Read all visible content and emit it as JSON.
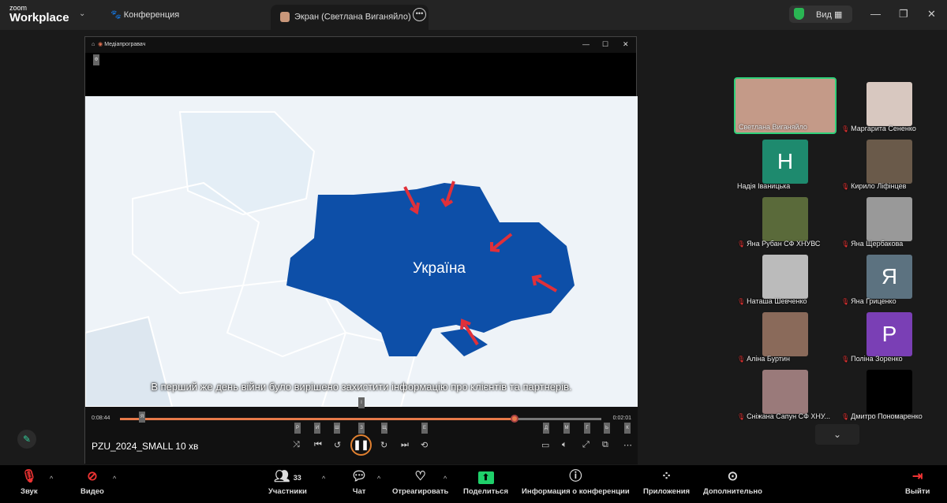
{
  "app": {
    "logo_small": "zoom",
    "logo_big": "Workplace",
    "tab_conference": "Конференция",
    "tab_screen": "Экран (Светлана Виганяйло)",
    "view_label": "Вид"
  },
  "player": {
    "title": "Медіапрогравач",
    "subtitle": "В перший же день війни було вирішено захистити інформацію про клієнтів та партнерів.",
    "map_label": "Україна",
    "time_elapsed": "0:08:44",
    "time_remaining": "0:02:01",
    "progress": 0.82,
    "file_name": "PZU_2024_SMALL 10 хв",
    "keys": [
      "Ф",
      "Я",
      "І",
      "Р",
      "И",
      "Ш",
      "З",
      "Щ",
      "Е",
      "Д",
      "М",
      "Г",
      "Ь",
      "К"
    ]
  },
  "participants": [
    {
      "name": "Светлана Виганяйло",
      "muted": false,
      "letter": "",
      "color": "#c49a88",
      "active": true
    },
    {
      "name": "Маргарита Сененко",
      "muted": true,
      "letter": "",
      "color": "#d8c8c0"
    },
    {
      "name": "Надія Іваницька",
      "muted": false,
      "letter": "H",
      "color": "#1e8a6e"
    },
    {
      "name": "Кирило Ліфінцев",
      "muted": true,
      "letter": "",
      "color": "#6a5a4a"
    },
    {
      "name": "Яна Рубан СФ ХНУВС",
      "muted": true,
      "letter": "",
      "color": "#5a6a3a"
    },
    {
      "name": "Яна Щербакова",
      "muted": true,
      "letter": "",
      "color": "#999"
    },
    {
      "name": "Наташа Шевченко",
      "muted": true,
      "letter": "",
      "color": "#bbb"
    },
    {
      "name": "Яна Гриценко",
      "muted": true,
      "letter": "Я",
      "color": "#5c7280"
    },
    {
      "name": "Аліна Буртин",
      "muted": true,
      "letter": "",
      "color": "#8a6a5a"
    },
    {
      "name": "Поліна Зоренко",
      "muted": true,
      "letter": "P",
      "color": "#7a3fb5"
    },
    {
      "name": "Сніжана Сапун СФ ХНУ...",
      "muted": true,
      "letter": "",
      "color": "#9a7a7a"
    },
    {
      "name": "Дмитро Пономаренко",
      "muted": true,
      "letter": "",
      "color": "#000"
    }
  ],
  "toolbar": {
    "audio": "Звук",
    "video": "Видео",
    "participants": "Участники",
    "participants_count": "33",
    "chat": "Чат",
    "react": "Отреагировать",
    "share": "Поделиться",
    "info": "Информация о конференции",
    "apps": "Приложения",
    "more": "Дополнительно",
    "leave": "Выйти"
  }
}
